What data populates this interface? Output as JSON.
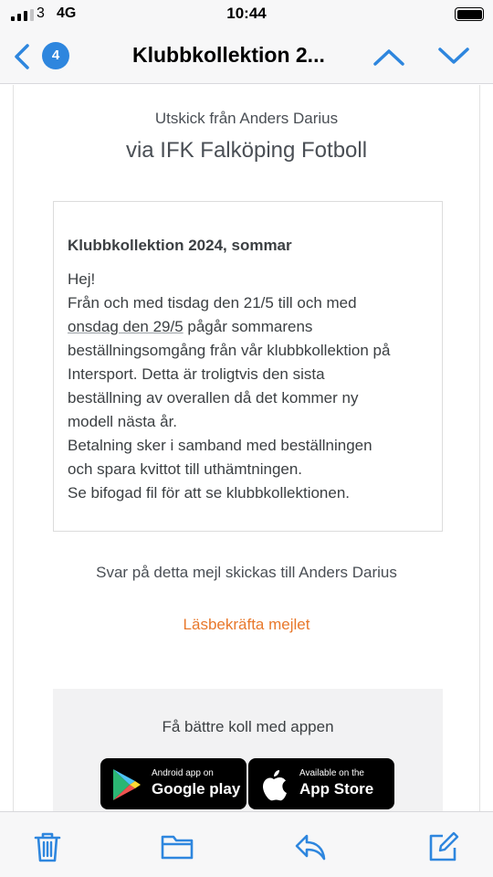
{
  "status_bar": {
    "carrier": "3",
    "network": "4G",
    "time": "10:44"
  },
  "nav": {
    "badge_count": "4",
    "title": "Klubbkollektion 2...",
    "accent_color": "#2e86de",
    "icons": {
      "back": "chevron-left-icon",
      "prev": "chevron-up-icon",
      "next": "chevron-down-icon"
    }
  },
  "mail": {
    "sender_line": "Utskick från Anders Darius",
    "via_line": "via IFK Falköping Fotboll",
    "message": {
      "title": "Klubbkollektion 2024, sommar",
      "lines": [
        "Hej!",
        "Från och med tisdag den 21/5 till och med",
        "onsdag den 29/5",
        " pågår sommarens",
        "beställningsomgång från vår klubbkollektion på",
        "Intersport. Detta är troligtvis den sista",
        "beställning av overallen då det kommer ny",
        "modell nästa år.",
        "Betalning sker i samband med beställningen",
        "och spara kvittot till uthämtningen.",
        "Se bifogad fil för att se klubbkollektionen."
      ]
    },
    "reply_note": "Svar på detta mejl skickas till Anders Darius",
    "read_receipt_link": "Läsbekräfta mejlet",
    "link_color": "#e8782b",
    "app_promo": {
      "text": "Få bättre koll med appen",
      "google": {
        "small": "Android app on",
        "big": "Google play"
      },
      "apple": {
        "small": "Available on the",
        "big": "App Store"
      }
    }
  },
  "toolbar": {
    "icons": [
      "trash-icon",
      "folder-icon",
      "reply-icon",
      "compose-icon"
    ]
  }
}
